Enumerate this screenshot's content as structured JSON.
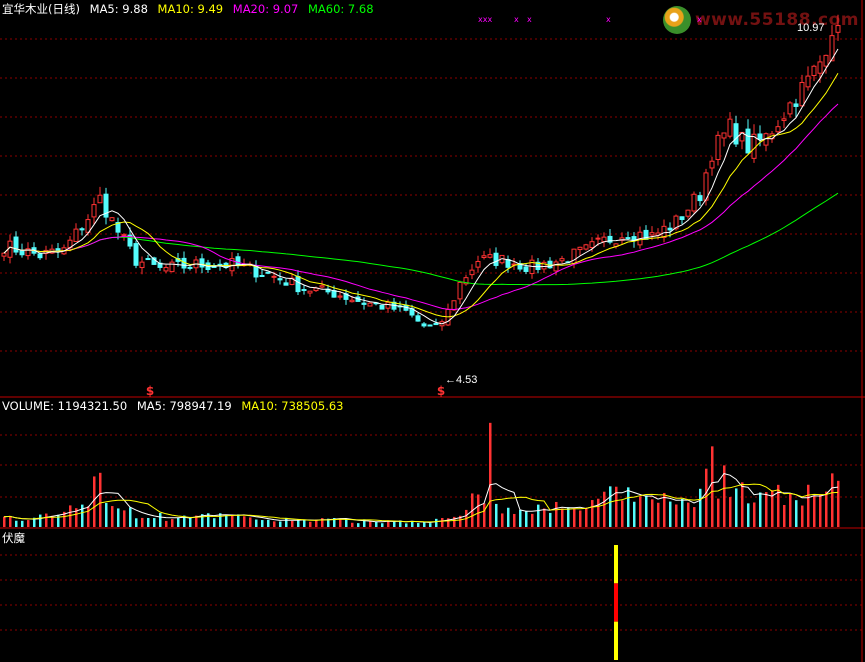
{
  "main_header": {
    "title": "宜华木业(日线)",
    "ma5": "MA5: 9.88",
    "ma10": "MA10: 9.49",
    "ma20": "MA20: 9.07",
    "ma60": "MA60: 7.68"
  },
  "volume_header": {
    "volume": "VOLUME: 1194321.50",
    "ma5": "MA5: 798947.19",
    "ma10": "MA10: 738505.63"
  },
  "indicator_header": {
    "name": "伏魔"
  },
  "watermark": {
    "text": "www.55188.com"
  },
  "colors": {
    "up": "#ff3232",
    "down": "#54fcfc",
    "ma5": "#ffffff",
    "ma10": "#ffff00",
    "ma20": "#ff00ff",
    "ma60": "#00ff00",
    "grid": "#8b0000",
    "frame": "#c00000"
  },
  "chart_data": {
    "type": "candlestick",
    "price_labels": {
      "high": "10.97",
      "low": "4.53"
    },
    "signal_marks": [
      "$",
      "$"
    ],
    "top_marks": [
      "xxx",
      "x",
      "x",
      "x",
      "x"
    ],
    "series": [
      {
        "name": "MA5",
        "final_value": 9.88
      },
      {
        "name": "MA10",
        "final_value": 9.49
      },
      {
        "name": "MA20",
        "final_value": 9.07
      },
      {
        "name": "MA60",
        "final_value": 7.68
      }
    ],
    "price_path": [
      [
        0,
        6.3
      ],
      [
        6,
        6.1
      ],
      [
        10,
        6.2
      ],
      [
        14,
        6.9
      ],
      [
        16,
        7.3
      ],
      [
        19,
        6.6
      ],
      [
        22,
        6.0
      ],
      [
        26,
        5.8
      ],
      [
        32,
        5.9
      ],
      [
        38,
        5.9
      ],
      [
        44,
        5.7
      ],
      [
        50,
        5.4
      ],
      [
        55,
        5.3
      ],
      [
        60,
        5.1
      ],
      [
        64,
        5.0
      ],
      [
        67,
        4.9
      ],
      [
        70,
        4.6
      ],
      [
        72,
        4.53
      ],
      [
        74,
        4.9
      ],
      [
        76,
        5.5
      ],
      [
        79,
        6.0
      ],
      [
        83,
        6.0
      ],
      [
        88,
        5.85
      ],
      [
        93,
        6.0
      ],
      [
        97,
        6.2
      ],
      [
        100,
        6.4
      ],
      [
        104,
        6.6
      ],
      [
        108,
        6.5
      ],
      [
        112,
        6.8
      ],
      [
        116,
        7.4
      ],
      [
        118,
        8.3
      ],
      [
        121,
        8.8
      ],
      [
        124,
        8.4
      ],
      [
        127,
        8.6
      ],
      [
        131,
        9.3
      ],
      [
        134,
        9.8
      ],
      [
        136,
        10.2
      ],
      [
        138,
        10.97
      ]
    ],
    "volume_path": [
      [
        0,
        0.07
      ],
      [
        5,
        0.07
      ],
      [
        10,
        0.12
      ],
      [
        14,
        0.28
      ],
      [
        16,
        0.4
      ],
      [
        19,
        0.22
      ],
      [
        22,
        0.12
      ],
      [
        26,
        0.09
      ],
      [
        32,
        0.09
      ],
      [
        38,
        0.09
      ],
      [
        44,
        0.07
      ],
      [
        50,
        0.06
      ],
      [
        55,
        0.06
      ],
      [
        60,
        0.05
      ],
      [
        64,
        0.05
      ],
      [
        67,
        0.05
      ],
      [
        72,
        0.06
      ],
      [
        76,
        0.08
      ],
      [
        78,
        0.3
      ],
      [
        80,
        0.18
      ],
      [
        83,
        0.16
      ],
      [
        88,
        0.14
      ],
      [
        93,
        0.18
      ],
      [
        97,
        0.18
      ],
      [
        100,
        0.24
      ],
      [
        103,
        0.3
      ],
      [
        106,
        0.25
      ],
      [
        110,
        0.22
      ],
      [
        114,
        0.2
      ],
      [
        116,
        0.34
      ],
      [
        118,
        0.45
      ],
      [
        120,
        0.34
      ],
      [
        123,
        0.3
      ],
      [
        126,
        0.25
      ],
      [
        129,
        0.28
      ],
      [
        132,
        0.25
      ],
      [
        135,
        0.28
      ],
      [
        138,
        0.36
      ]
    ],
    "indicator_signal": {
      "bar_index": 102,
      "colors": [
        "#ffff00",
        "#ff0000",
        "#ffff00"
      ]
    }
  }
}
